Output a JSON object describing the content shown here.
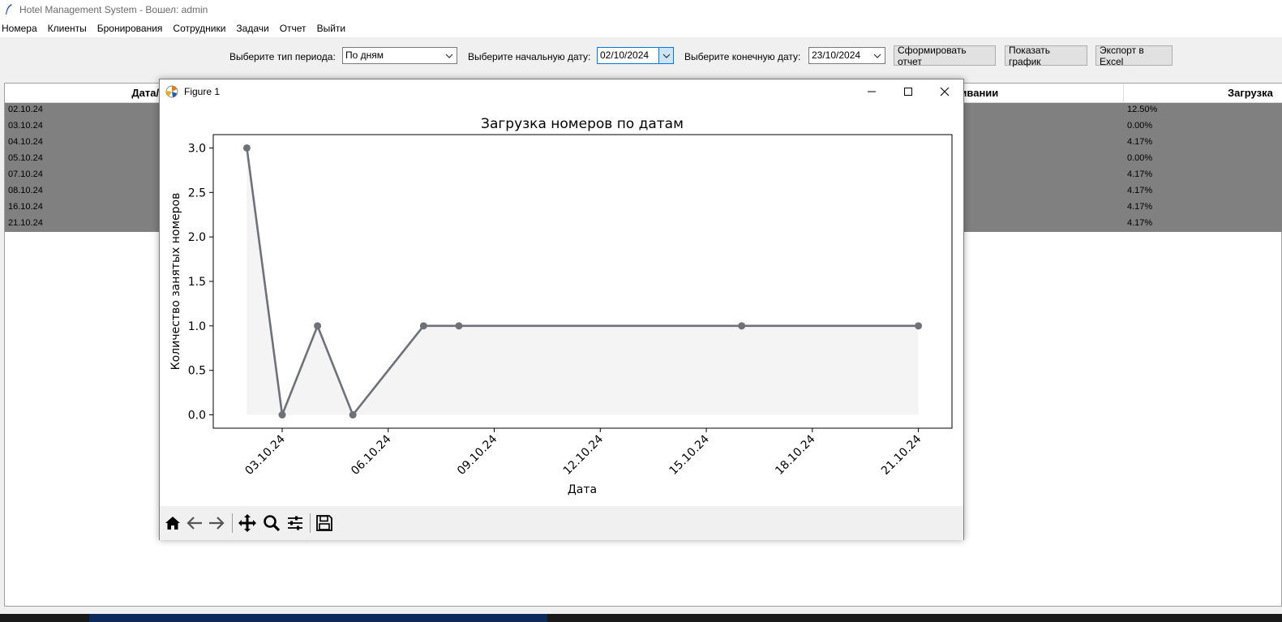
{
  "app": {
    "title": "Hotel Management System - Вошел: admin"
  },
  "menu": [
    "Номера",
    "Клиенты",
    "Бронирования",
    "Сотрудники",
    "Задачи",
    "Отчет",
    "Выйти"
  ],
  "toolbar": {
    "period_label": "Выберите тип периода:",
    "period_value": "По дням",
    "start_label": "Выберите начальную дату:",
    "start_value": "02/10/2024",
    "end_label": "Выберите конечную дату:",
    "end_value": "23/10/2024",
    "generate_button": "Сформировать отчет",
    "chart_button": "Показать график",
    "export_button": "Экспорт в Excel"
  },
  "table": {
    "headers": [
      "Дата/Пери",
      "луживании",
      "Загрузка"
    ],
    "rows": [
      {
        "date": "02.10.24",
        "load": "12.50%"
      },
      {
        "date": "03.10.24",
        "load": "0.00%"
      },
      {
        "date": "04.10.24",
        "load": "4.17%"
      },
      {
        "date": "05.10.24",
        "load": "0.00%"
      },
      {
        "date": "07.10.24",
        "load": "4.17%"
      },
      {
        "date": "08.10.24",
        "load": "4.17%"
      },
      {
        "date": "16.10.24",
        "load": "4.17%"
      },
      {
        "date": "21.10.24",
        "load": "4.17%"
      }
    ]
  },
  "figure": {
    "window_title": "Figure 1",
    "nav_icons": [
      "home-icon",
      "back-icon",
      "forward-icon",
      "pan-icon",
      "zoom-icon",
      "configure-icon",
      "save-icon"
    ]
  },
  "chart_data": {
    "type": "line",
    "title": "Загрузка номеров по датам",
    "xlabel": "Дата",
    "ylabel": "Количество занятых номеров",
    "x": [
      "02.10.24",
      "03.10.24",
      "04.10.24",
      "05.10.24",
      "07.10.24",
      "08.10.24",
      "16.10.24",
      "21.10.24"
    ],
    "y": [
      3,
      0,
      1,
      0,
      1,
      1,
      1,
      1
    ],
    "xticks": [
      "03.10.24",
      "06.10.24",
      "09.10.24",
      "12.10.24",
      "15.10.24",
      "18.10.24",
      "21.10.24"
    ],
    "yticks": [
      "0.0",
      "0.5",
      "1.0",
      "1.5",
      "2.0",
      "2.5",
      "3.0"
    ],
    "ylim": [
      0,
      3
    ],
    "xlim": [
      "02.10.24",
      "21.10.24"
    ],
    "grid": false,
    "fill_under": true,
    "line_color": "#6e7278",
    "fill_color": "#f4f4f5"
  }
}
